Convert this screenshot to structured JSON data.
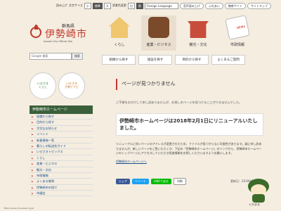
{
  "util": {
    "text_reader": "読み上げ",
    "font_size_label": "文字サイズ",
    "font_small": "小",
    "font_standard": "標準",
    "font_large": "大",
    "bg_color_label": "背景色変更",
    "bg_white": "白",
    "bg_black": "黒",
    "language": "Foreign Language",
    "help_btn": "音声読み上げ",
    "mobile": "ふれあい",
    "mobile_site": "携帯サイト",
    "sitemap": "サイトマップ"
  },
  "logo": {
    "prefecture": "群馬県",
    "city": "伊勢崎市",
    "english": "Isesaki City Official Site"
  },
  "tiles": [
    {
      "label": "くらし",
      "icon": "house-icon"
    },
    {
      "label": "産業・ビジネス",
      "icon": "briefcase-icon"
    },
    {
      "label": "観光・文化",
      "icon": "temple-icon"
    },
    {
      "label": "市政情報",
      "icon": "newspaper-icon"
    }
  ],
  "nav": [
    "組織から探す",
    "施設を探す",
    "目的から探す",
    "よくあるご質問"
  ],
  "search": {
    "placeholder": "Google 検索",
    "button": "検索"
  },
  "promo": [
    {
      "label": "いせさき\nくらし",
      "color": "#2a7a2a"
    },
    {
      "label": "いせさき\n子育てナビ",
      "color": "#c06b12"
    }
  ],
  "main": {
    "page_title": "ページが見つかりません",
    "note": "ご不便をおかけして申し訳ありませんが、お探しのページを見つけることができませんでした。",
    "heading": "伊勢崎市ホームページは2018年2月1日にリニューアルいたしました。",
    "body": "リニューアルに伴いページのアドレスが変更されたため、ファイルが見つからない可能性があります。誠に申し訳ありませんが、新しいページをご覧いただくか、下記の「伊勢崎市ホームページ」のリンクから、伊勢崎市ホームページのトップページにアクセスしていただき再度情報をお探しくださいますようお願いします。",
    "link": "伊勢崎市ホームページへ"
  },
  "sidebar": {
    "header": "伊勢崎市ホームページ",
    "items": [
      "組織から探す",
      "目的から探す",
      "大切なお知らせ",
      "イベント",
      "新着情報一覧",
      "暮らしの転送先ガイド",
      "いせさきトピックス",
      "くらし",
      "産業・ビジネス",
      "観光・文化",
      "市政情報",
      "よくある質問",
      "伊勢崎市の紹介",
      "市議会"
    ]
  },
  "share": {
    "fb": "シェア",
    "tw": "ツイート",
    "ln": "LINEで送る",
    "print": "印刷",
    "updated": "更新日：2018年02月06日"
  },
  "mascot": {
    "name": "くわまる"
  },
  "bottom": "https://www.city.isesaki.lg.jp/"
}
